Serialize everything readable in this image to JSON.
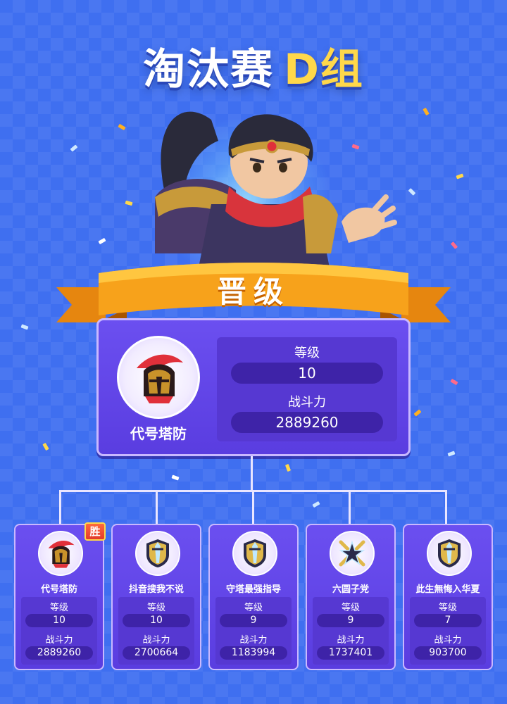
{
  "header": {
    "title_main": "淘汰赛",
    "title_group": "D组"
  },
  "banner": {
    "label": "晋级"
  },
  "winner": {
    "name": "代号塔防",
    "level_label": "等级",
    "level": "10",
    "power_label": "战斗力",
    "power": "2889260",
    "avatar_icon": "spartan-helmet-icon"
  },
  "participants": [
    {
      "name": "代号塔防",
      "level_label": "等级",
      "level": "10",
      "power_label": "战斗力",
      "power": "2889260",
      "badge": "胜",
      "avatar_icon": "spartan-helmet-icon"
    },
    {
      "name": "抖音搜我不说",
      "level_label": "等级",
      "level": "10",
      "power_label": "战斗力",
      "power": "2700664",
      "avatar_icon": "sword-crest-icon"
    },
    {
      "name": "守塔最强指导",
      "level_label": "等级",
      "level": "9",
      "power_label": "战斗力",
      "power": "1183994",
      "avatar_icon": "sword-crest-icon"
    },
    {
      "name": "六圆子党",
      "level_label": "等级",
      "level": "9",
      "power_label": "战斗力",
      "power": "1737401",
      "avatar_icon": "crossed-swords-star-icon"
    },
    {
      "name": "此生無悔入华夏",
      "level_label": "等级",
      "level": "7",
      "power_label": "战斗力",
      "power": "903700",
      "avatar_icon": "sword-crest-icon"
    }
  ],
  "colors": {
    "background": "#3f6ff0",
    "card": "#5a3de0",
    "pill": "#3e23a8",
    "title_accent": "#ffd84a",
    "ribbon": "#f7a21b"
  }
}
